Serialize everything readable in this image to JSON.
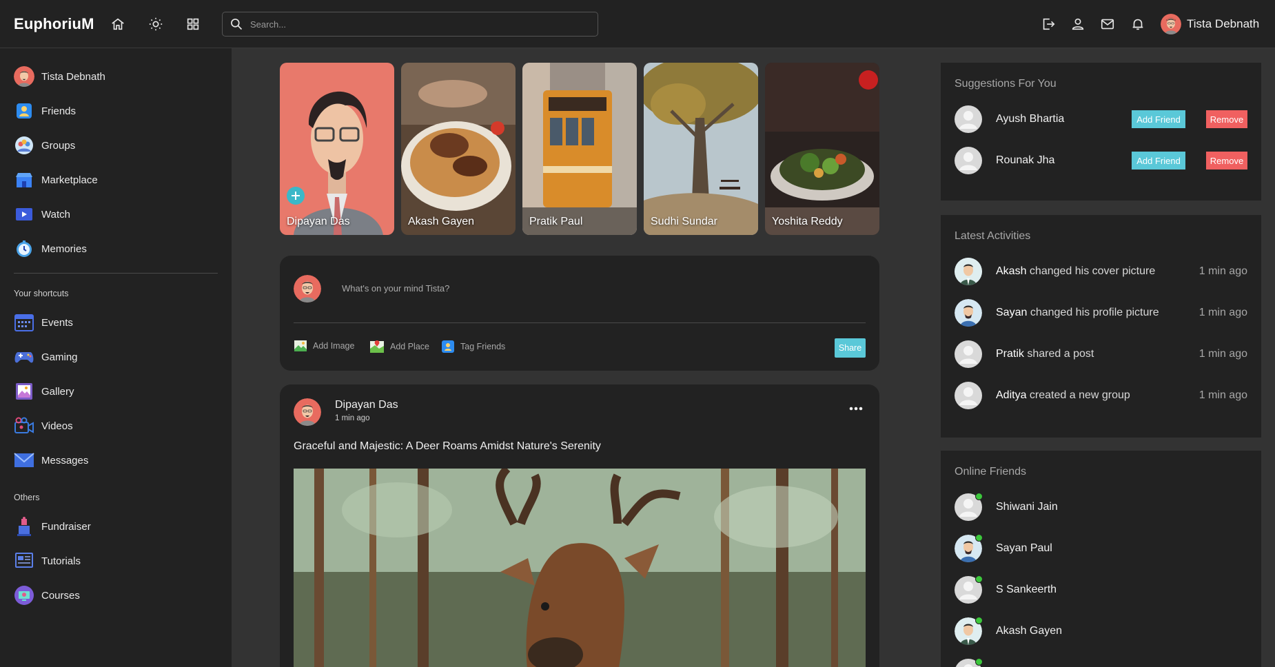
{
  "navbar": {
    "logo": "EuphoriuM",
    "search_placeholder": "Search...",
    "user_name": "Tista Debnath",
    "icons": [
      "home-icon",
      "sun-icon",
      "grid-icon",
      "logout-icon",
      "person-icon",
      "mail-icon",
      "bell-icon"
    ]
  },
  "sidebar": {
    "main_items": [
      {
        "label": "Tista Debnath",
        "icon": "avatar"
      },
      {
        "label": "Friends",
        "icon": "friends-icon"
      },
      {
        "label": "Groups",
        "icon": "groups-icon"
      },
      {
        "label": "Marketplace",
        "icon": "marketplace-icon"
      },
      {
        "label": "Watch",
        "icon": "watch-icon"
      },
      {
        "label": "Memories",
        "icon": "memories-icon"
      }
    ],
    "shortcuts_heading": "Your shortcuts",
    "shortcuts": [
      {
        "label": "Events",
        "icon": "events-icon"
      },
      {
        "label": "Gaming",
        "icon": "gaming-icon"
      },
      {
        "label": "Gallery",
        "icon": "gallery-icon"
      },
      {
        "label": "Videos",
        "icon": "videos-icon"
      },
      {
        "label": "Messages",
        "icon": "messages-icon"
      }
    ],
    "others_heading": "Others",
    "others": [
      {
        "label": "Fundraiser",
        "icon": "fundraiser-icon"
      },
      {
        "label": "Tutorials",
        "icon": "tutorials-icon"
      },
      {
        "label": "Courses",
        "icon": "courses-icon"
      }
    ]
  },
  "stories": [
    {
      "name": "Dipayan Das"
    },
    {
      "name": "Akash Gayen"
    },
    {
      "name": "Pratik Paul"
    },
    {
      "name": "Sudhi Sundar"
    },
    {
      "name": "Yoshita Reddy"
    }
  ],
  "compose": {
    "placeholder": "What's on your mind Tista?",
    "add_image": "Add Image",
    "add_place": "Add Place",
    "tag_friends": "Tag Friends",
    "share": "Share"
  },
  "post": {
    "author": "Dipayan Das",
    "time": "1 min ago",
    "text": "Graceful and Majestic: A Deer Roams Amidst Nature's Serenity"
  },
  "suggestions": {
    "title": "Suggestions For You",
    "add_label": "Add Friend",
    "remove_label": "Remove",
    "people": [
      {
        "name": "Ayush Bhartia"
      },
      {
        "name": "Rounak Jha"
      }
    ]
  },
  "activities": {
    "title": "Latest Activities",
    "items": [
      {
        "name": "Akash",
        "action": "changed his cover picture",
        "time": "1 min ago"
      },
      {
        "name": "Sayan",
        "action": "changed his profile picture",
        "time": "1 min ago"
      },
      {
        "name": "Pratik",
        "action": "shared a post",
        "time": "1 min ago"
      },
      {
        "name": "Aditya",
        "action": "created a new group",
        "time": "1 min ago"
      }
    ]
  },
  "online": {
    "title": "Online Friends",
    "friends": [
      {
        "name": "Shiwani Jain"
      },
      {
        "name": "Sayan Paul"
      },
      {
        "name": "S Sankeerth"
      },
      {
        "name": "Akash Gayen"
      }
    ]
  },
  "colors": {
    "accent": "#5ac8d8",
    "danger": "#f06060",
    "online": "#3cc73c",
    "panel": "#222222",
    "page": "#333333"
  }
}
